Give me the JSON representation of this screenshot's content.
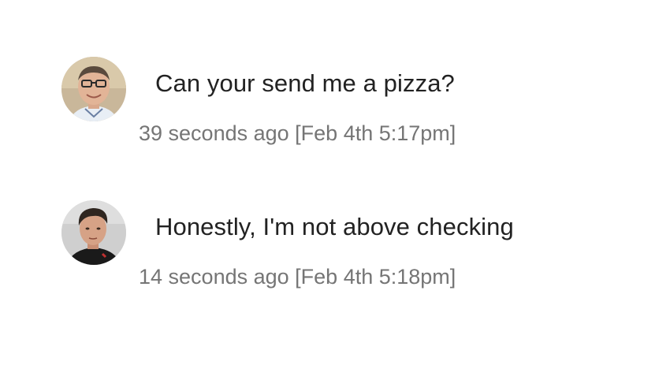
{
  "messages": [
    {
      "avatar_icon": "user-avatar-older-man-glasses",
      "text": "Can your send me a pizza?",
      "relative_time": "39 seconds ago",
      "timestamp": "[Feb 4th 5:17pm]"
    },
    {
      "avatar_icon": "user-avatar-young-man",
      "text": "Honestly, I'm not above checking",
      "relative_time": "14 seconds ago",
      "timestamp": "[Feb 4th 5:18pm]"
    }
  ],
  "colors": {
    "message_text": "#222222",
    "meta_text": "#757575",
    "background": "#ffffff"
  }
}
